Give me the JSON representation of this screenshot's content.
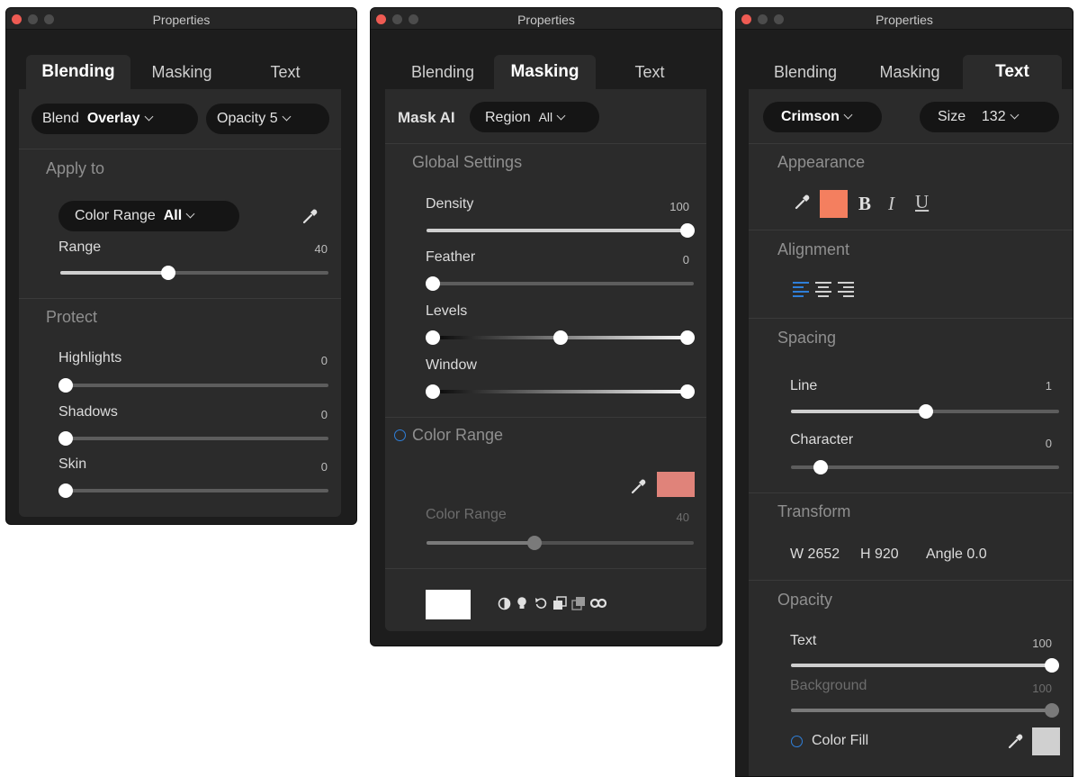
{
  "colors": {
    "accent": "#2f7fd9",
    "swatch_text": "#f47f5f",
    "swatch_mask": "#e0837a",
    "swatch_fill": "#d0d0d0"
  },
  "win1": {
    "title": "Properties",
    "tabs": [
      "Blending",
      "Masking",
      "Text"
    ],
    "blend": {
      "label": "Blend",
      "value": "Overlay"
    },
    "opacity": {
      "label": "Opacity",
      "value": "5"
    },
    "apply_to": "Apply to",
    "color_range": {
      "label": "Color Range",
      "value": "All"
    },
    "range": {
      "label": "Range",
      "value": "40"
    },
    "protect": "Protect",
    "highlights": {
      "label": "Highlights",
      "value": "0"
    },
    "shadows": {
      "label": "Shadows",
      "value": "0"
    },
    "skin": {
      "label": "Skin",
      "value": "0"
    }
  },
  "win2": {
    "title": "Properties",
    "tabs": [
      "Blending",
      "Masking",
      "Text"
    ],
    "mask_ai": "Mask AI",
    "region": {
      "label": "Region",
      "value": "All"
    },
    "global": "Global Settings",
    "density": {
      "label": "Density",
      "value": "100"
    },
    "feather": {
      "label": "Feather",
      "value": "0"
    },
    "levels": {
      "label": "Levels"
    },
    "window": {
      "label": "Window"
    },
    "color_range_sect": "Color Range",
    "color_range": {
      "label": "Color Range",
      "value": "40"
    }
  },
  "win3": {
    "title": "Properties",
    "tabs": [
      "Blending",
      "Masking",
      "Text"
    ],
    "font": "Crimson",
    "size": {
      "label": "Size",
      "value": "132"
    },
    "appearance": "Appearance",
    "style_bold": "B",
    "style_italic": "I",
    "style_underline": "U",
    "alignment": "Alignment",
    "spacing": "Spacing",
    "line": {
      "label": "Line",
      "value": "1"
    },
    "character": {
      "label": "Character",
      "value": "0"
    },
    "transform": "Transform",
    "w": "W 2652",
    "h": "H 920",
    "angle": "Angle 0.0",
    "opacity": "Opacity",
    "text_op": {
      "label": "Text",
      "value": "100"
    },
    "bg_op": {
      "label": "Background",
      "value": "100"
    },
    "color_fill": "Color Fill"
  }
}
